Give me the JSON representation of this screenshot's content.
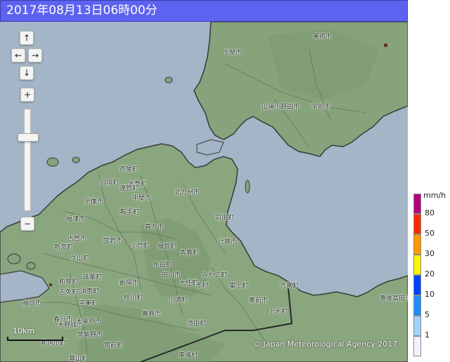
{
  "title": "2017年08月13日06時00分",
  "controls": {
    "pan_up": "↑",
    "pan_left": "←",
    "pan_right": "→",
    "pan_down": "↓",
    "zoom_in": "+",
    "zoom_out": "−"
  },
  "scale": {
    "label": "10km"
  },
  "copyright": "© Japan Meteorological Agency 2017",
  "legend": {
    "unit": "mm/h",
    "bins": [
      {
        "label": "80",
        "color": "#b4007a"
      },
      {
        "label": "50",
        "color": "#ff2800"
      },
      {
        "label": "30",
        "color": "#ff9900"
      },
      {
        "label": "20",
        "color": "#faf500"
      },
      {
        "label": "10",
        "color": "#0041ff"
      },
      {
        "label": "5",
        "color": "#218cff"
      },
      {
        "label": "1",
        "color": "#a0d2ff"
      },
      {
        "label": "",
        "color": "#f2f2ff"
      }
    ]
  },
  "places": [
    {
      "name": "美祢市"
    },
    {
      "name": "下関市"
    },
    {
      "name": "山陽小野田市"
    },
    {
      "name": "宇部市"
    },
    {
      "name": "芦屋町"
    },
    {
      "name": "岡垣町"
    },
    {
      "name": "水巻町"
    },
    {
      "name": "遠賀町"
    },
    {
      "name": "北九州市"
    },
    {
      "name": "中間市"
    },
    {
      "name": "宗像市"
    },
    {
      "name": "鞍手町"
    },
    {
      "name": "苅田町"
    },
    {
      "name": "福津市"
    },
    {
      "name": "直方市"
    },
    {
      "name": "宮若市"
    },
    {
      "name": "古賀市"
    },
    {
      "name": "新宮町"
    },
    {
      "name": "小竹町"
    },
    {
      "name": "福智町"
    },
    {
      "name": "行橋市"
    },
    {
      "name": "久山町"
    },
    {
      "name": "香春町"
    },
    {
      "name": "糸田町"
    },
    {
      "name": "粕屋町"
    },
    {
      "name": "篠栗町"
    },
    {
      "name": "飯塚市"
    },
    {
      "name": "田川市"
    },
    {
      "name": "みやこ町"
    },
    {
      "name": "志免町"
    },
    {
      "name": "須恵町"
    },
    {
      "name": "大任町"
    },
    {
      "name": "赤村"
    },
    {
      "name": "築上町"
    },
    {
      "name": "吉富町"
    },
    {
      "name": "福岡市"
    },
    {
      "name": "宇美町"
    },
    {
      "name": "桂川町"
    },
    {
      "name": "川崎町"
    },
    {
      "name": "豊前市"
    },
    {
      "name": "豊後高田市"
    },
    {
      "name": "嘉麻市"
    },
    {
      "name": "上毛町"
    },
    {
      "name": "春日市"
    },
    {
      "name": "大野城市"
    },
    {
      "name": "太宰府市"
    },
    {
      "name": "筑紫野市"
    },
    {
      "name": "添田町"
    },
    {
      "name": "那珂川町"
    },
    {
      "name": "筑前町"
    },
    {
      "name": "東峰村"
    },
    {
      "name": "基山町"
    }
  ]
}
